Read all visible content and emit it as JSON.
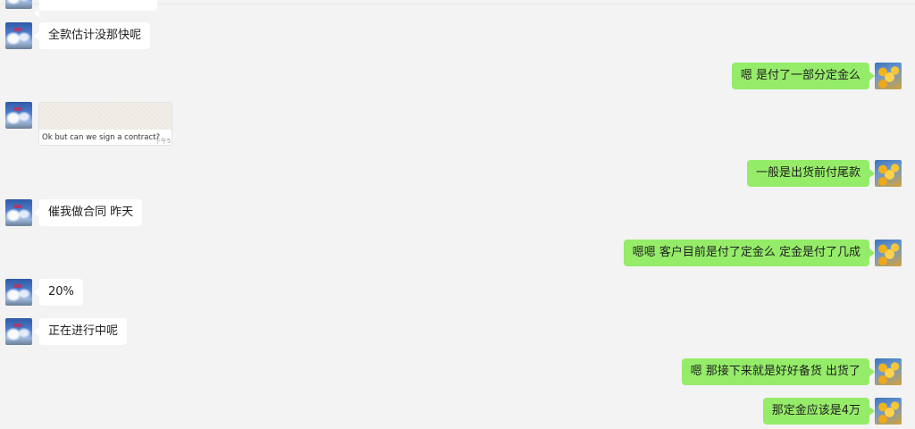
{
  "chat": {
    "messages": [
      {
        "id": "m0",
        "side": "left",
        "type": "text",
        "text": ""
      },
      {
        "id": "m1",
        "side": "left",
        "type": "text",
        "text": "全款估计没那快呢"
      },
      {
        "id": "m2",
        "side": "right",
        "type": "text",
        "text": "嗯  是付了一部分定金么"
      },
      {
        "id": "m3",
        "side": "left",
        "type": "image",
        "caption": "Ok but can we sign a contract?",
        "time": "下午5:2"
      },
      {
        "id": "m4",
        "side": "right",
        "type": "text",
        "text": "一般是出货前付尾款"
      },
      {
        "id": "m5",
        "side": "left",
        "type": "text",
        "text": "催我做合同  昨天"
      },
      {
        "id": "m6",
        "side": "right",
        "type": "text",
        "text": "嗯嗯 客户目前是付了定金么   定金是付了几成"
      },
      {
        "id": "m7",
        "side": "left",
        "type": "text",
        "text": "20%"
      },
      {
        "id": "m8",
        "side": "left",
        "type": "text",
        "text": "正在进行中呢"
      },
      {
        "id": "m9",
        "side": "right",
        "type": "text",
        "text": "嗯 那接下来就是好好备货 出货了"
      },
      {
        "id": "m10",
        "side": "right",
        "type": "text",
        "text": "那定金应该是4万"
      }
    ]
  },
  "colors": {
    "background": "#f3f3f3",
    "bubble_left": "#ffffff",
    "bubble_right": "#95ec69",
    "text": "#1f1f1f"
  },
  "icons": {
    "contact_avatar": "sky-avatar-icon",
    "self_avatar": "flower-avatar-icon"
  }
}
